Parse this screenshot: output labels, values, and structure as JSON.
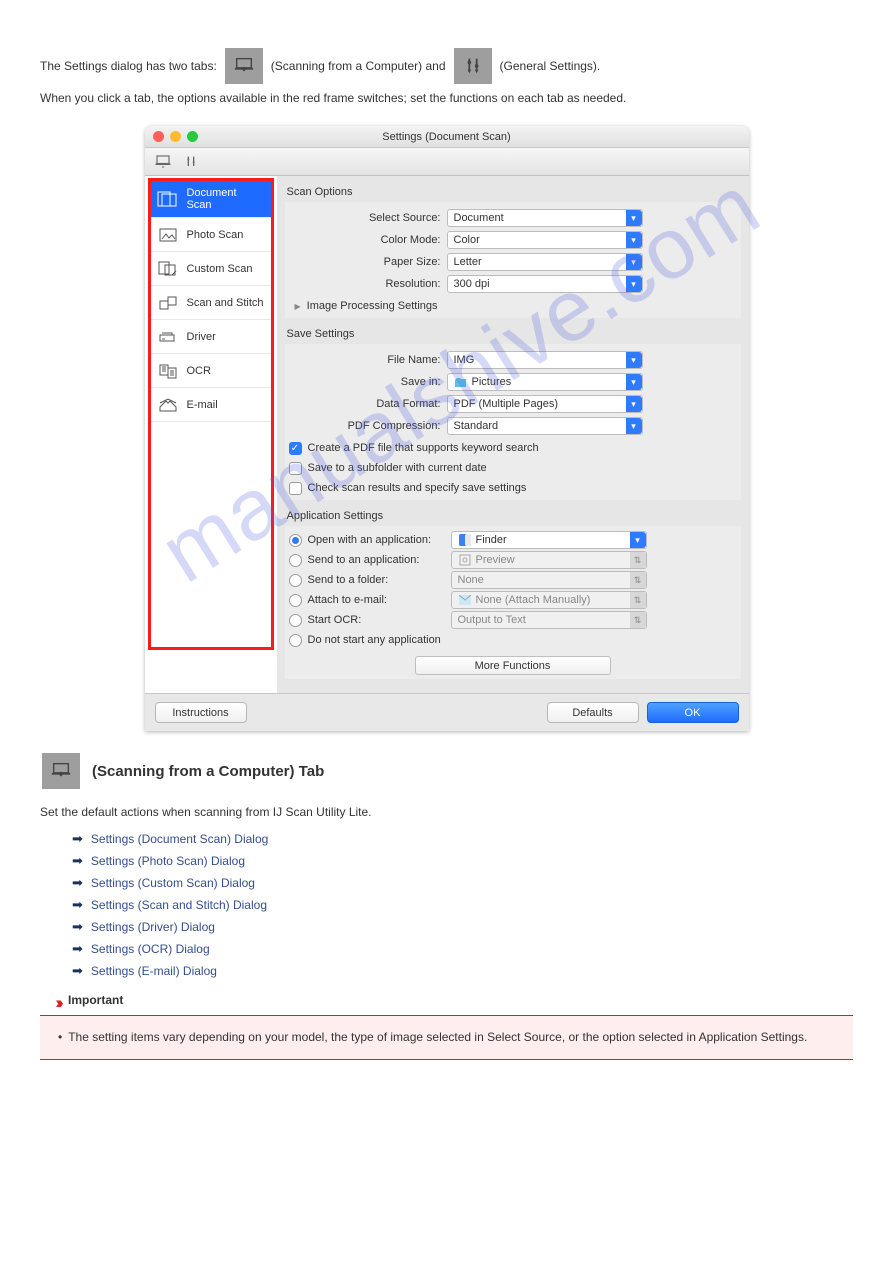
{
  "watermark": "manualshive.com",
  "intro": {
    "pre1": "The Settings dialog has two tabs: ",
    "scanLabel": " (Scanning from a Computer) and ",
    "genLabel": " (General Settings).",
    "line2": "When you click a tab, the options available in the red frame switches; set the functions on each tab as needed."
  },
  "dialog": {
    "title": "Settings (Document Scan)"
  },
  "sidebar": {
    "items": [
      {
        "label": "Document Scan"
      },
      {
        "label": "Photo Scan"
      },
      {
        "label": "Custom Scan"
      },
      {
        "label": "Scan and Stitch"
      },
      {
        "label": "Driver"
      },
      {
        "label": "OCR"
      },
      {
        "label": "E-mail"
      }
    ]
  },
  "scanOptions": {
    "header": "Scan Options",
    "selectSourceLabel": "Select Source:",
    "selectSourceValue": "Document",
    "colorModeLabel": "Color Mode:",
    "colorModeValue": "Color",
    "paperSizeLabel": "Paper Size:",
    "paperSizeValue": "Letter",
    "resolutionLabel": "Resolution:",
    "resolutionValue": "300 dpi",
    "imageProcessing": "Image Processing Settings"
  },
  "saveSettings": {
    "header": "Save Settings",
    "fileNameLabel": "File Name:",
    "fileNameValue": "IMG",
    "saveInLabel": "Save in:",
    "saveInValue": "Pictures",
    "dataFormatLabel": "Data Format:",
    "dataFormatValue": "PDF (Multiple Pages)",
    "pdfCompLabel": "PDF Compression:",
    "pdfCompValue": "Standard",
    "chk1": "Create a PDF file that supports keyword search",
    "chk2": "Save to a subfolder with current date",
    "chk3": "Check scan results and specify save settings"
  },
  "appSettings": {
    "header": "Application Settings",
    "r1": "Open with an application:",
    "r1v": "Finder",
    "r2": "Send to an application:",
    "r2v": "Preview",
    "r3": "Send to a folder:",
    "r3v": "None",
    "r4": "Attach to e-mail:",
    "r4v": "None (Attach Manually)",
    "r5": "Start OCR:",
    "r5v": "Output to Text",
    "r6": "Do not start any application",
    "moreFn": "More Functions"
  },
  "buttons": {
    "instructions": "Instructions",
    "defaults": "Defaults",
    "ok": "OK"
  },
  "below": {
    "tabTitle": "(Scanning from a Computer) Tab",
    "para": "Set the default actions when scanning from IJ Scan Utility Lite.",
    "links": [
      "Settings (Document Scan) Dialog",
      "Settings (Photo Scan) Dialog",
      "Settings (Custom Scan) Dialog",
      "Settings (Scan and Stitch) Dialog",
      "Settings (Driver) Dialog",
      "Settings (OCR) Dialog",
      "Settings (E-mail) Dialog"
    ],
    "importantLabel": "Important",
    "importantBody": "The setting items vary depending on your model, the type of image selected in Select Source, or the option selected in Application Settings."
  },
  "icons": {
    "computerTab": "computer-tab-icon",
    "generalTab": "general-tab-icon"
  }
}
